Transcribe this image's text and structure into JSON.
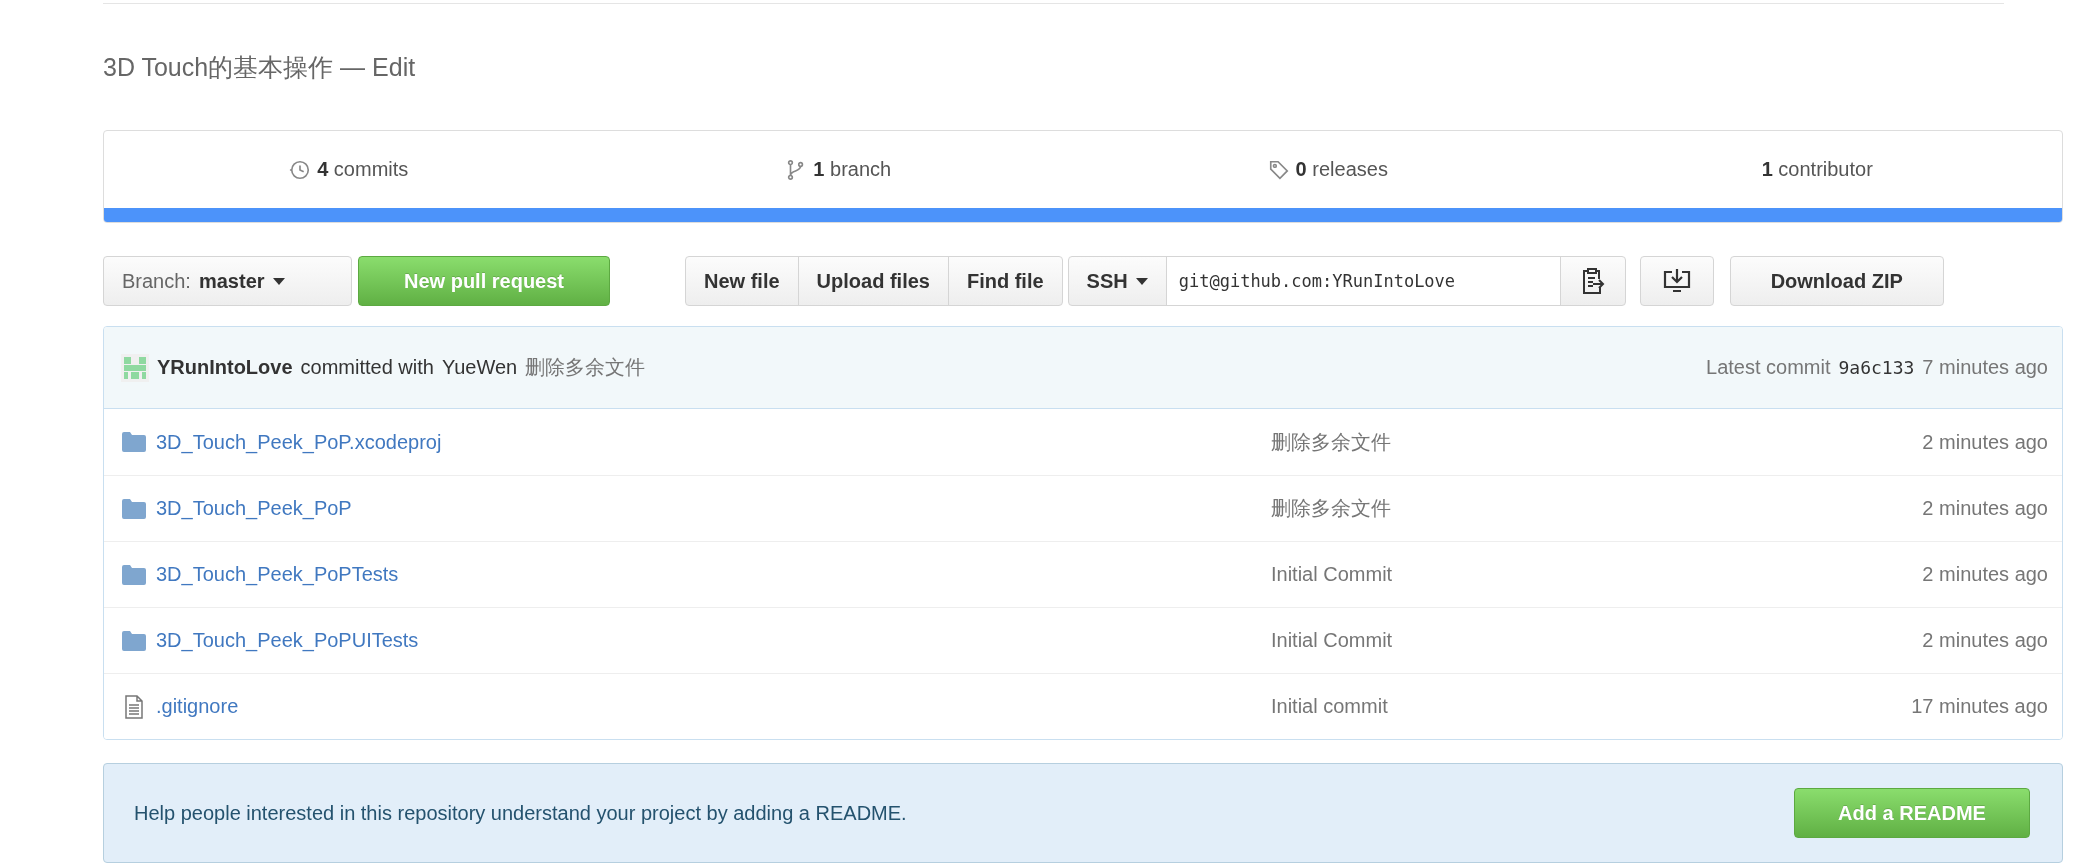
{
  "title": "3D Touch的基本操作 — Edit",
  "stats": [
    {
      "kind": "commits",
      "count": "4",
      "label": "commits"
    },
    {
      "kind": "branch",
      "count": "1",
      "label": "branch"
    },
    {
      "kind": "releases",
      "count": "0",
      "label": "releases"
    },
    {
      "kind": "contributor",
      "count": "1",
      "label": "contributor"
    }
  ],
  "branch_button": {
    "label": "Branch:",
    "value": "master"
  },
  "pull_request_button": "New pull request",
  "file_buttons": [
    "New file",
    "Upload files",
    "Find file"
  ],
  "clone": {
    "protocol": "SSH",
    "url": "git@github.com:YRunIntoLove"
  },
  "download_button": "Download ZIP",
  "latest_commit": {
    "author": "YRunIntoLove",
    "verb": "committed with",
    "coauthor": "YueWen",
    "message": "删除多余文件",
    "label": "Latest commit",
    "sha": "9a6c133",
    "age": "7 minutes ago"
  },
  "files": [
    {
      "kind": "folder",
      "name": "3D_Touch_Peek_PoP.xcodeproj",
      "message": "删除多余文件",
      "age": "2 minutes ago"
    },
    {
      "kind": "folder",
      "name": "3D_Touch_Peek_PoP",
      "message": "删除多余文件",
      "age": "2 minutes ago"
    },
    {
      "kind": "folder",
      "name": "3D_Touch_Peek_PoPTests",
      "message": "Initial Commit",
      "age": "2 minutes ago"
    },
    {
      "kind": "folder",
      "name": "3D_Touch_Peek_PoPUITests",
      "message": "Initial Commit",
      "age": "2 minutes ago"
    },
    {
      "kind": "file",
      "name": ".gitignore",
      "message": "Initial commit",
      "age": "17 minutes ago"
    }
  ],
  "readme_prompt": {
    "text": "Help people interested in this repository understand your project by adding a README.",
    "button": "Add a README"
  }
}
